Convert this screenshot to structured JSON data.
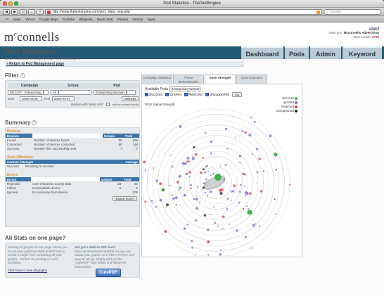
{
  "browser": {
    "window_title": "Pod Statistics - TheTextEngine",
    "url": "http://www.thetextengine.com/pod_stats_new.php",
    "search_placeholder": "Google",
    "bookmarks": [
      "Apple",
      "Yahoo!",
      "Google Maps",
      "YouTube",
      "Wikipedia",
      "News (364)",
      "Popular",
      "Zamzar",
      "logos"
    ],
    "toolbar_buttons": [
      "back-icon",
      "forward-icon",
      "reload-icon",
      "home-icon",
      "add-icon"
    ]
  },
  "header": {
    "logo_m": "m",
    "logo_c": "c",
    "logo_rest": "connells",
    "logout": "Logout",
    "welcome_prefix": "Welcome:",
    "welcome_name": "Mcconnells Advertising",
    "sms_prefix": "SMS credits:",
    "sms_credits": "6795"
  },
  "nav": {
    "tabs": [
      {
        "label": "Dashboard"
      },
      {
        "label": "Pods"
      },
      {
        "label": "Admin"
      },
      {
        "label": "Keyword"
      }
    ]
  },
  "page": {
    "title": "Pod Statistics",
    "subtitle": "Show statistics for pods, groups and campaigns.",
    "return_link": "Return to Pod Management page"
  },
  "filter": {
    "title": "Filter",
    "col_campaign": "Campaign",
    "col_group": "Group",
    "col_pod": "Pod",
    "campaign_value": "MCCGP - Enterprising",
    "group_value": "All",
    "pod_value": "Enterprising Women",
    "start_label": "Start",
    "start_value": "2009-03-25",
    "end_label": "End",
    "end_value": "2009-03-27",
    "refresh": "Refresh",
    "update_label": "Update with latest info?",
    "update_note": "(will be a slower lookup)"
  },
  "summary": {
    "title": "Summary",
    "devices_heading": "Devices",
    "devices_header": [
      "Devices",
      "",
      "Unique",
      "Total"
    ],
    "devices_rows": [
      [
        "Found",
        "Number of devices found",
        "90",
        "155"
      ],
      [
        "Contacted",
        "Number of devices contacted",
        "90",
        "148"
      ],
      [
        "Success",
        "Number files successfully sent",
        "7",
        "7"
      ]
    ],
    "zone_heading": "Zone Efficiency",
    "zone_header": [
      "Contact Attempts",
      "Average"
    ],
    "zone_rows": [
      [
        "Success",
        "Resulting in success",
        ""
      ]
    ],
    "errors_heading": "Errors",
    "errors_header": [
      "Errors",
      "",
      "Unique",
      "Total"
    ],
    "errors_rows": [
      [
        "Rejected",
        "User refused to accept data",
        "28",
        "32"
      ],
      [
        "Failed",
        "Incompatible device",
        "2",
        "6"
      ],
      [
        "Ignored",
        "No response from device",
        "",
        "100"
      ]
    ],
    "export": "Export (CSV)"
  },
  "allstats": {
    "title": "All Stats on one page?",
    "left_text": "Viewing all graphs on one page allows you to use your preferred Web-to-PDF tool to create a single PDF containing all your graphs - Perfect for printing out and archiving.",
    "left_link": "Click here to view all graphs",
    "right_title": "Not got a Web-to-PDF tool?",
    "right_text": "Why not download CutePDF so you can output your graphs as a PDF? It's free and easy to set up. Simply click on the \"CutePDF\" logo below and follow the instructions.",
    "cutepdf": "CutePDF"
  },
  "chart_tabs": [
    {
      "label": "Campaign Statistics"
    },
    {
      "label": "Phone Makes/Models"
    },
    {
      "label": "Zone Strength"
    },
    {
      "label": "Zone Exposure"
    }
  ],
  "chart_controls": {
    "available_pods_label": "Available Pods",
    "pod_value": "Enterprising Women",
    "checks": [
      "Success",
      "Ignored",
      "Rejected",
      "Unsupported"
    ],
    "go": "Go"
  },
  "chart_data": {
    "type": "scatter",
    "title": "",
    "ylabel": "RSSI Signal Strength",
    "legend_position": "top-right",
    "series": [
      {
        "name": "Success",
        "color": "#3cb44b"
      },
      {
        "name": "Ignored",
        "color": "#7b6fd6"
      },
      {
        "name": "Rejected",
        "color": "#e23b3b"
      },
      {
        "name": "Unsupported",
        "color": "#222222"
      }
    ]
  }
}
